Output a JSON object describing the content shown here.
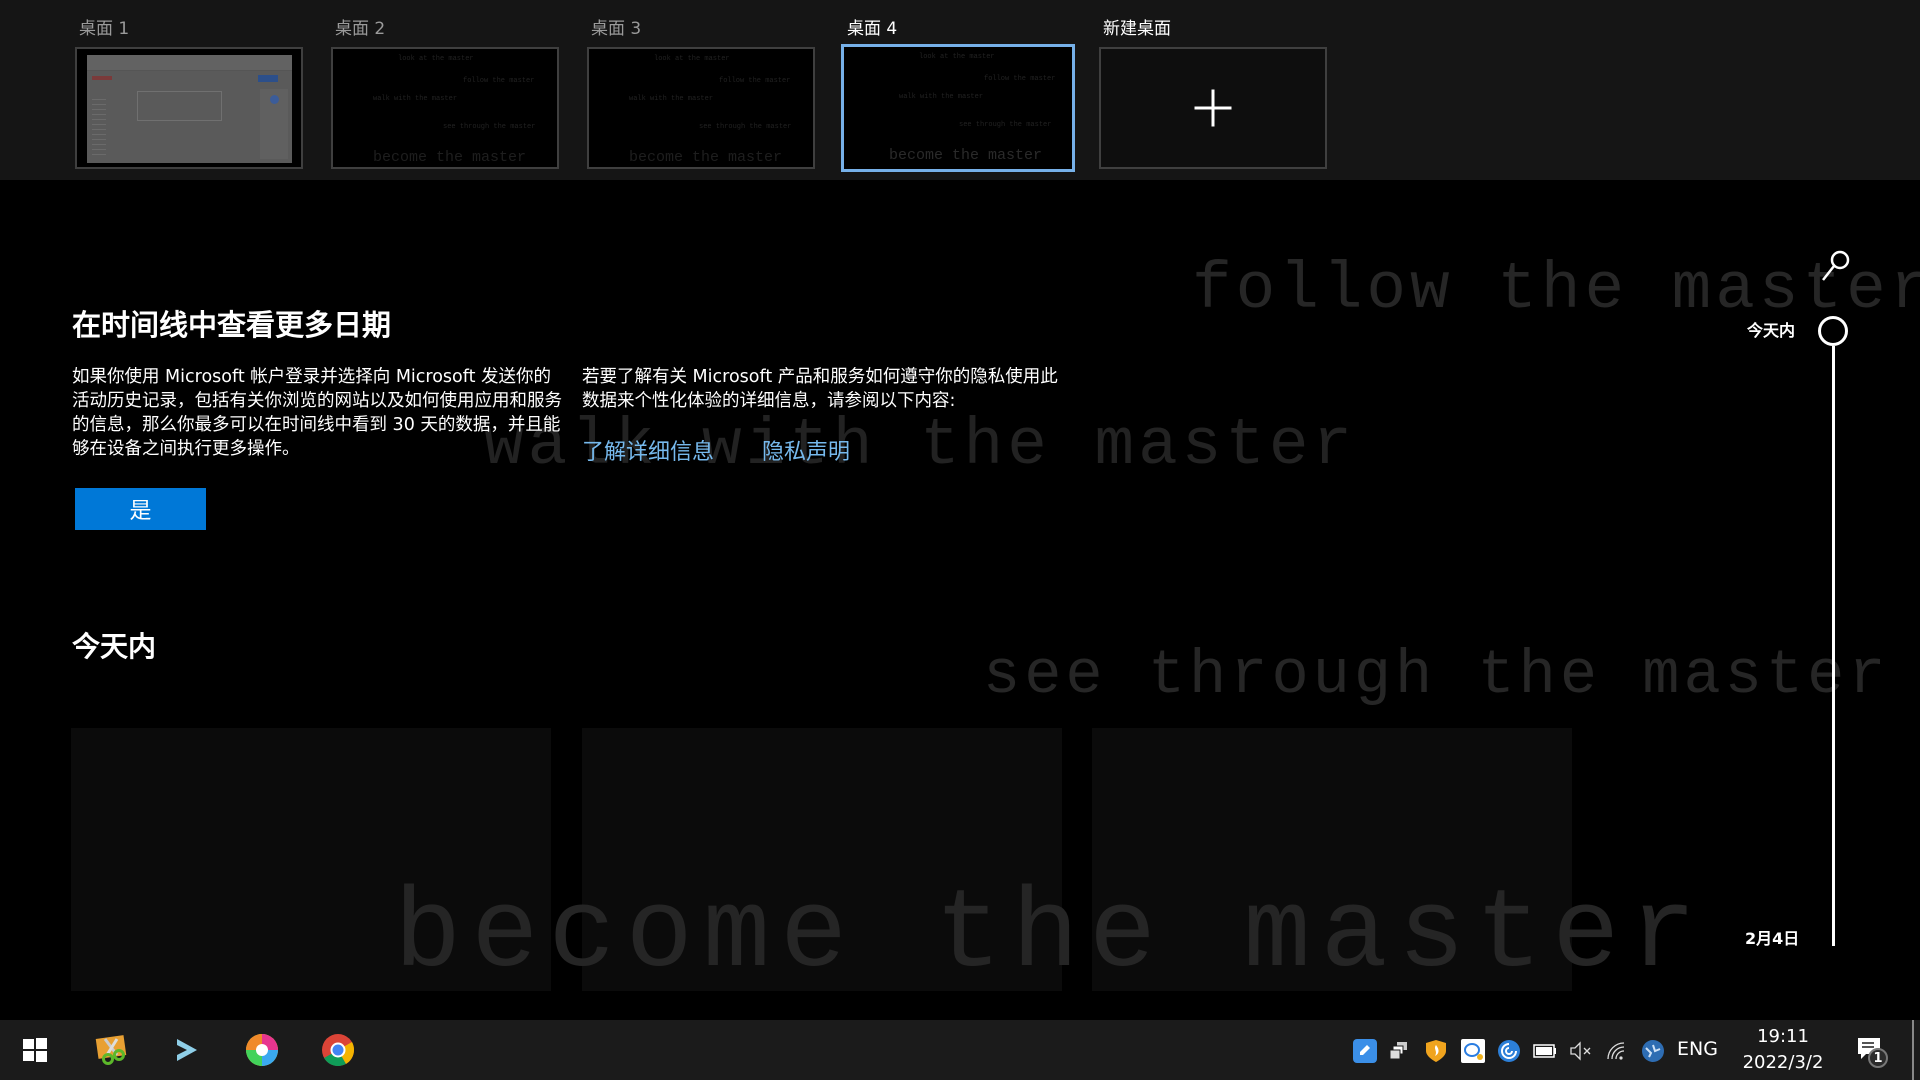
{
  "desktops": [
    {
      "label": "桌面 1",
      "active": false
    },
    {
      "label": "桌面 2",
      "active": false
    },
    {
      "label": "桌面 3",
      "active": false
    },
    {
      "label": "桌面 4",
      "active": true
    }
  ],
  "new_desktop": {
    "label": "新建桌面",
    "icon": "plus-icon"
  },
  "thumbnail_lines": [
    "look at the master",
    "follow the master",
    "walk with the master",
    "see through the master",
    "become the master"
  ],
  "wallpaper_text": {
    "follow": "follow the master",
    "walk": "walk with the master",
    "see": "see through the master",
    "become": "become the master"
  },
  "promo": {
    "title": "在时间线中查看更多日期",
    "left_text": "如果你使用 Microsoft 帐户登录并选择向 Microsoft 发送你的活动历史记录，包括有关你浏览的网站以及如何使用应用和服务的信息，那么你最多可以在时间线中看到 30 天的数据，并且能够在设备之间执行更多操作。",
    "right_text": "若要了解有关 Microsoft 产品和服务如何遵守你的隐私使用此数据来个性化体验的详细信息，请参阅以下内容:",
    "link_learn_more": "了解详细信息",
    "link_privacy": "隐私声明",
    "yes_button": "是"
  },
  "section": {
    "title": "今天内"
  },
  "timeline": {
    "today_label": "今天内",
    "date_label": "2月4日",
    "search_icon": "search-icon"
  },
  "taskbar": {
    "apps": [
      {
        "name": "start",
        "icon": "windows-icon"
      },
      {
        "name": "snipping-tool",
        "icon": "scissors-icon"
      },
      {
        "name": "terminal-app",
        "icon": "chevron-right-icon"
      },
      {
        "name": "color-app",
        "icon": "color-swirl-icon"
      },
      {
        "name": "chrome",
        "icon": "chrome-icon"
      }
    ],
    "tray": [
      {
        "name": "notes-app",
        "icon": "pencil-icon"
      },
      {
        "name": "windows-group",
        "icon": "windows-stack-icon"
      },
      {
        "name": "security-app",
        "icon": "shield-icon"
      },
      {
        "name": "chat-app",
        "icon": "chat-icon"
      },
      {
        "name": "sync-app",
        "icon": "swirl-icon"
      },
      {
        "name": "battery",
        "icon": "battery-icon"
      },
      {
        "name": "volume",
        "icon": "volume-muted-icon"
      },
      {
        "name": "wifi",
        "icon": "wifi-icon"
      },
      {
        "name": "network-app",
        "icon": "globe-icon"
      }
    ],
    "language": "ENG",
    "time": "19:11",
    "date": "2022/3/2",
    "notification_count": "1"
  },
  "colors": {
    "accent": "#0078d7",
    "link": "#76b9ed",
    "active_border": "#76b0e8",
    "taskbar": "#1b1b1b"
  }
}
